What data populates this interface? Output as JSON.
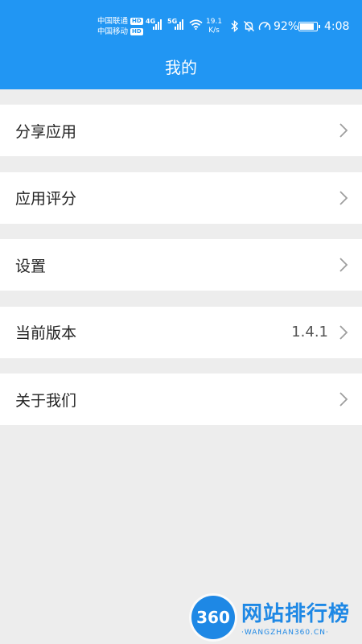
{
  "status_bar": {
    "carrier1": "中国联通",
    "carrier2": "中国移动",
    "hd_badge": "HD",
    "net1": "4G",
    "net2": "5G",
    "speed_value": "19.1",
    "speed_unit": "K/s",
    "battery_percent": "92%",
    "battery_level": 0.92,
    "time": "4:08"
  },
  "header": {
    "title": "我的"
  },
  "menu": {
    "items": [
      {
        "label": "分享应用",
        "value": ""
      },
      {
        "label": "应用评分",
        "value": ""
      },
      {
        "label": "设置",
        "value": ""
      },
      {
        "label": "当前版本",
        "value": "1.4.1"
      },
      {
        "label": "关于我们",
        "value": ""
      }
    ]
  },
  "watermark": {
    "badge": "360",
    "name": "网站排行榜",
    "site": "·WANGZHAN360.CN·"
  },
  "colors": {
    "accent": "#2196f3",
    "background": "#ededed",
    "chevron": "#9e9e9e"
  }
}
